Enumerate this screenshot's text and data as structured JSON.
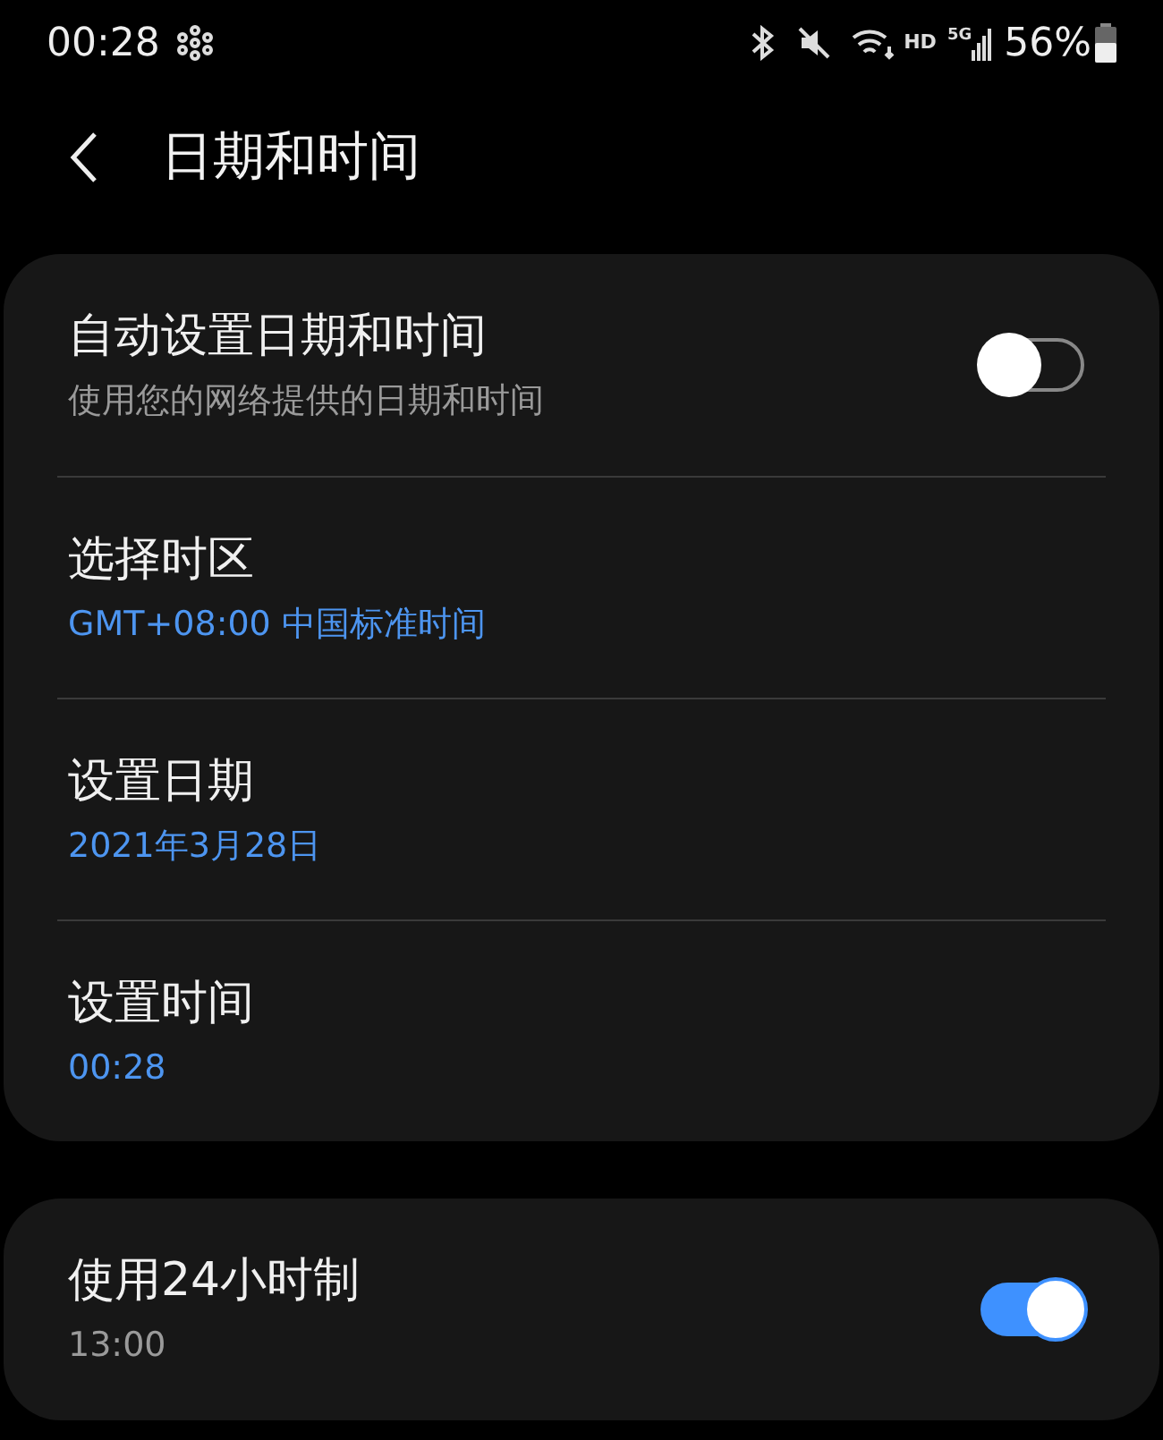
{
  "status_bar": {
    "time": "00:28",
    "network_label": "HD",
    "signal_label": "5G",
    "battery": "56%"
  },
  "header": {
    "title": "日期和时间"
  },
  "groups": [
    {
      "rows": [
        {
          "kind": "toggle",
          "title": "自动设置日期和时间",
          "subtitle": "使用您的网络提供的日期和时间",
          "on": false
        },
        {
          "kind": "link",
          "title": "选择时区",
          "value": "GMT+08:00 中国标准时间"
        },
        {
          "kind": "link",
          "title": "设置日期",
          "value": "2021年3月28日"
        },
        {
          "kind": "link",
          "title": "设置时间",
          "value": "00:28"
        }
      ]
    },
    {
      "rows": [
        {
          "kind": "toggle",
          "title": "使用24小时制",
          "subtitle": "13:00",
          "on": true
        }
      ]
    }
  ]
}
